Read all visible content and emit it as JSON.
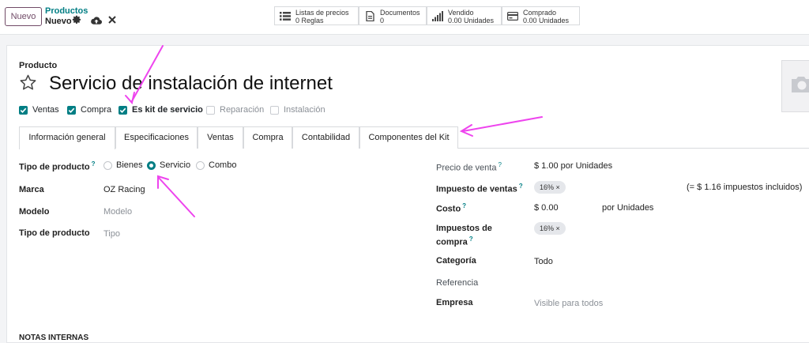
{
  "toolbar": {
    "new_button": "Nuevo",
    "breadcrumb_parent": "Productos",
    "breadcrumb_current": "Nuevo"
  },
  "smart_buttons": [
    {
      "title": "Listas de precios",
      "value": "0 Reglas",
      "icon": "list-icon"
    },
    {
      "title": "Documentos",
      "value": "0",
      "icon": "document-icon"
    },
    {
      "title": "Vendido",
      "value": "0.00 Unidades",
      "icon": "signal-bars-icon"
    },
    {
      "title": "Comprado",
      "value": "0.00 Unidades",
      "icon": "credit-card-icon"
    }
  ],
  "header": {
    "label": "Producto",
    "name": "Servicio de instalación de internet"
  },
  "options": [
    {
      "label": "Ventas",
      "checked": true
    },
    {
      "label": "Compra",
      "checked": true
    },
    {
      "label": "Es kit de servicio",
      "checked": true
    },
    {
      "label": "Reparación",
      "checked": false
    },
    {
      "label": "Instalación",
      "checked": false
    }
  ],
  "tabs": [
    {
      "label": "Información general",
      "active": true
    },
    {
      "label": "Especificaciones",
      "active": false
    },
    {
      "label": "Ventas",
      "active": false
    },
    {
      "label": "Compra",
      "active": false
    },
    {
      "label": "Contabilidad",
      "active": false
    },
    {
      "label": "Componentes del Kit",
      "active": false
    }
  ],
  "left_fields": {
    "product_type_label": "Tipo de producto",
    "product_type_options": [
      "Bienes",
      "Servicio",
      "Combo"
    ],
    "product_type_selected": "Servicio",
    "brand_label": "Marca",
    "brand_value": "OZ Racing",
    "model_label": "Modelo",
    "model_placeholder": "Modelo",
    "type_label": "Tipo de producto",
    "type_placeholder": "Tipo"
  },
  "right_fields": {
    "sale_price_label": "Precio de venta",
    "sale_price_value": "$ 1.00 por Unidades",
    "sales_tax_label": "Impuesto de ventas",
    "sales_tax_tag": "16%",
    "tax_included_note": "(= $ 1.16 impuestos incluidos)",
    "cost_label": "Costo",
    "cost_value": "$ 0.00",
    "cost_unit": "por Unidades",
    "purchase_tax_label_1": "Impuestos de",
    "purchase_tax_label_2": "compra",
    "purchase_tax_tag": "16%",
    "category_label": "Categoría",
    "category_value": "Todo",
    "reference_label": "Referencia",
    "company_label": "Empresa",
    "company_placeholder": "Visible para todos"
  },
  "notes_heading": "NOTAS INTERNAS",
  "help_marker": "?",
  "tag_remove": "×",
  "colors": {
    "accent": "#017e84",
    "brand": "#714b67",
    "annotation": "#ee44ee"
  }
}
